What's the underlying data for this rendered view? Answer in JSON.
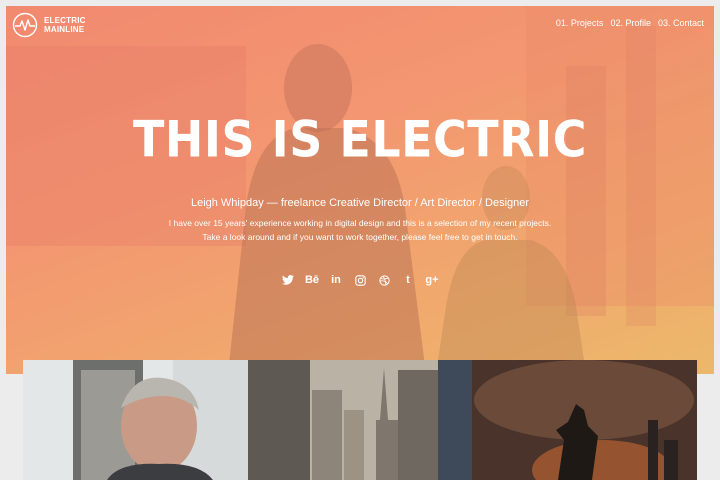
{
  "site": {
    "logo_line1": "ELECTRIC",
    "logo_line2": "MAINLINE"
  },
  "nav": {
    "items": [
      {
        "label": "01. Projects"
      },
      {
        "label": "02. Profile"
      },
      {
        "label": "03. Contact"
      }
    ]
  },
  "hero": {
    "headline": "THIS IS ELECTRIC",
    "subheading": "Leigh Whipday — freelance Creative Director / Art Director / Designer",
    "intro_line1": "I have over 15 years' experience working in digital design and this is a selection of my recent projects.",
    "intro_line2": "Take a look around and if you want to work together, please feel free to get in touch."
  },
  "social": {
    "icons": [
      "twitter-icon",
      "behance-icon",
      "linkedin-icon",
      "instagram-icon",
      "dribbble-icon",
      "tumblr-icon",
      "google-plus-icon"
    ],
    "glyphs": [
      "",
      "Bē",
      "in",
      "",
      "",
      "t",
      "g+"
    ]
  },
  "colors": {
    "hero_gradient_start": "#f2876f",
    "hero_gradient_end": "#e9c66a",
    "text": "#ffffff",
    "page_background": "#ececec"
  }
}
